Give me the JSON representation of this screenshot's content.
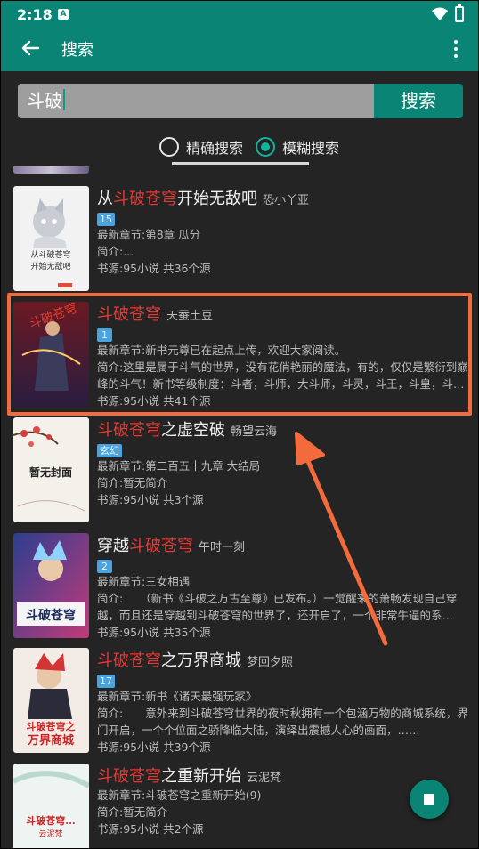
{
  "status": {
    "time": "2:18",
    "notif_letter": "A"
  },
  "toolbar": {
    "title": "搜索"
  },
  "search": {
    "query": "斗破",
    "button_label": "搜索"
  },
  "radios": [
    {
      "label": "精确搜索",
      "selected": false
    },
    {
      "label": "模糊搜索",
      "selected": true
    }
  ],
  "books": [
    {
      "title_prefix": "从",
      "title_highlight": "斗破苍穹",
      "title_suffix": "开始无敌吧",
      "author": "恐小丫亚",
      "badge": "15",
      "latest": "最新章节:第8章 瓜分",
      "intro": "简介:...",
      "source": "书源:95小说 共36个源",
      "cover_text": [
        "从斗破苍穹",
        "开始无敌吧"
      ]
    },
    {
      "title_prefix": "",
      "title_highlight": "斗破苍穹",
      "title_suffix": "",
      "author": "天蚕土豆",
      "badge": "1",
      "latest": "最新章节:新书元尊已在起点上传，欢迎大家阅读。",
      "intro": "简介:这里是属于斗气的世界，没有花俏艳丽的魔法，有的，仅仅是繁衍到巅峰的斗气！新书等级制度：斗者，斗师，大斗师，斗灵，斗王，斗皇，斗宗，斗尊，斗圣，斗帝。",
      "source": "书源:95小说 共41个源",
      "cover_text": [
        "斗破苍穹"
      ]
    },
    {
      "title_prefix": "",
      "title_highlight": "斗破苍穹",
      "title_suffix": "之虚空破",
      "author": "畅望云海",
      "badge": "玄幻",
      "latest": "最新章节:第二百五十九章 大结局",
      "intro": "简介:暂无简介",
      "source": "书源:95小说 共3个源",
      "cover_text": [
        "暂无封面"
      ]
    },
    {
      "title_prefix": "穿越",
      "title_highlight": "斗破苍穹",
      "title_suffix": "",
      "author": "午时一刻",
      "badge": "2",
      "latest": "最新章节:三女相遇",
      "intro": "简介:　　（新书《斗破之万古至尊》已发布。）一觉醒来的萧畅发现自己穿越，而且还是穿越到斗破苍穹的世界了，还开启了，一个非常牛逼的系统……",
      "source": "书源:95小说 共35个源",
      "cover_text": [
        "斗破苍穹"
      ]
    },
    {
      "title_prefix": "",
      "title_highlight": "斗破苍穹",
      "title_suffix": "之万界商城",
      "author": "梦回夕照",
      "badge": "17",
      "latest": "最新章节:新书《诸天最强玩家》",
      "intro": "简介:　　意外来到斗破苍穹世界的夜时秋拥有一个包涵万物的商城系统，界门开启，一个个位面之骄降临大陆，演绎出震撼人心的画面，……",
      "source": "书源:95小说 共39个源",
      "cover_text": [
        "斗破苍穹之",
        "万界商城"
      ]
    },
    {
      "title_prefix": "",
      "title_highlight": "斗破苍穹",
      "title_suffix": "之重新开始",
      "author": "云泥梵",
      "badge": "",
      "latest": "最新章节:斗破苍穹之重新开始(9)",
      "intro": "简介:暂无简介",
      "source": "书源:95小说 共2个源",
      "cover_text": [
        "斗破苍穹...",
        "云泥梵"
      ]
    }
  ],
  "colors": {
    "accent": "#0a8575",
    "highlight": "#e53935",
    "annotation": "#f36a3c"
  }
}
